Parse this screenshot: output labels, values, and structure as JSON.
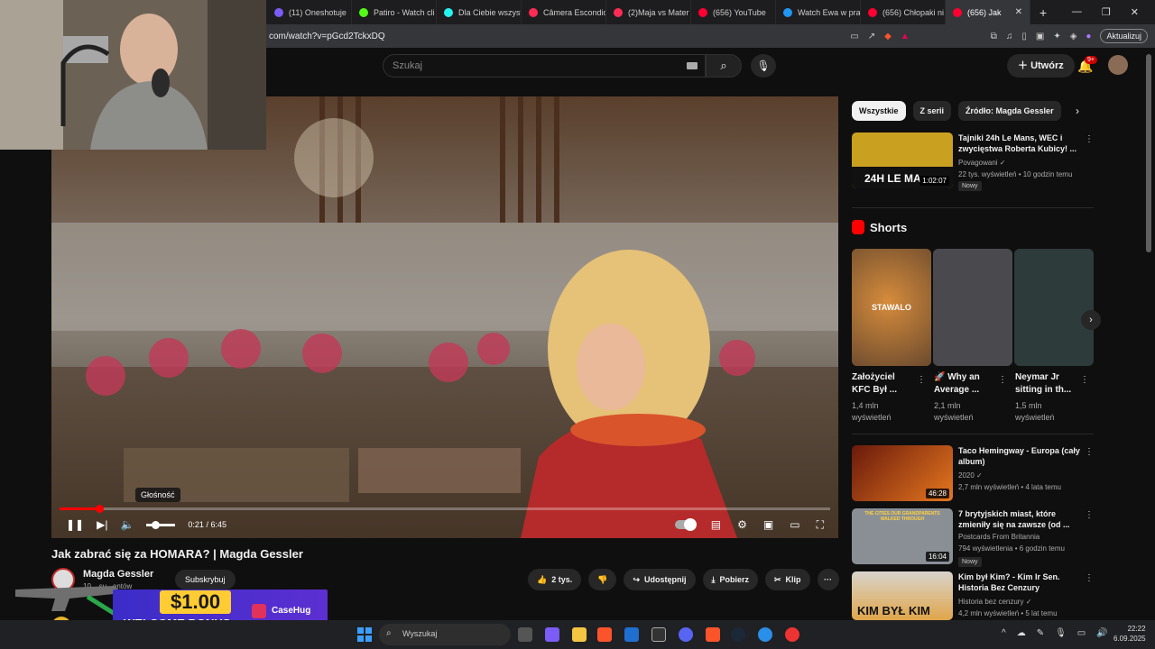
{
  "browser": {
    "tabs": [
      {
        "label": "(11) Oneshotuje",
        "color": "#7b5cf6"
      },
      {
        "label": "Patiro - Watch cli",
        "color": "#53fc18"
      },
      {
        "label": "Dla Ciebie wszyst",
        "color": "#25f4ee"
      },
      {
        "label": "Câmera Escondid",
        "color": "#fe2c55"
      },
      {
        "label": "(2)Maja vs Mater",
        "color": "#fe2c55"
      },
      {
        "label": "(656) YouTube",
        "color": "#ff0033"
      },
      {
        "label": "Watch Ewa w pra",
        "color": "#2196f3"
      },
      {
        "label": "(656) Chłopaki ni",
        "color": "#ff0033"
      },
      {
        "label": "(656) Jak",
        "color": "#ff0033",
        "active": true
      }
    ],
    "new_tab": "+",
    "url": "com/watch?v=pGcd2TckxDQ",
    "update_label": "Aktualizuj",
    "window_controls": [
      "—",
      "❐",
      "✕"
    ]
  },
  "header": {
    "search_placeholder": "Szukaj",
    "create_label": "Utwórz",
    "notifications": "9+"
  },
  "player": {
    "tooltip": "Głośność",
    "time": "0:21 / 6:45",
    "progress": 0.052,
    "volume": 0.3
  },
  "video": {
    "title": "Jak zabrać się za HOMARA? | Magda Gessler",
    "channel": "Magda Gessler",
    "subs_text": "10... su...entów",
    "subscribe_label": "Subskrybuj",
    "likes": "2 tys.",
    "share_label": "Udostępnij",
    "download_label": "Pobierz",
    "clip_label": "Klip",
    "more": "···"
  },
  "promo": {
    "amount": "$1.00",
    "sub": "WELCOME BONUS",
    "brand": "CaseHug"
  },
  "chips": [
    "Wszystkie",
    "Z serii",
    "Źródło: Magda Gessler"
  ],
  "recommendations_top": [
    {
      "title": "Tajniki 24h Le Mans, WEC i zwycięstwa Roberta Kubicy! ...",
      "channel": "Povagowani ✓",
      "meta": "22 tys. wyświetleń • 10 godzin temu",
      "badge": "Nowy",
      "duration": "1:02:07",
      "thumb_text": "24H LE MA"
    }
  ],
  "shorts": {
    "heading": "Shorts",
    "items": [
      {
        "title": "Założyciel KFC Był ...",
        "views": "1,4 mln wyświetleń",
        "thumb_text": "STAWALO"
      },
      {
        "title": "🚀 Why an Average ...",
        "views": "2,1 mln wyświetleń"
      },
      {
        "title": "Neymar Jr sitting in th...",
        "views": "1,5 mln wyświetleń"
      }
    ]
  },
  "recommendations": [
    {
      "title": "Taco Hemingway - Europa (cały album)",
      "channel": "2020 ✓",
      "meta": "2,7 mln wyświetleń • 4 lata temu",
      "duration": "46:28"
    },
    {
      "title": "7 brytyjskich miast, które zmieniły się na zawsze (od ...",
      "channel": "Postcards From Britannia",
      "meta": "794 wyświetlenia • 6 godzin temu",
      "badge": "Nowy",
      "duration": "16:04",
      "thumb_text": "THE CITIES OUR GRANDPARENTS WALKED THROUGH"
    },
    {
      "title": "Kim był Kim? - Kim Ir Sen. Historia Bez Cenzury",
      "channel": "Historia bez cenzury ✓",
      "meta": "4,2 mln wyświetleń • 5 lat temu",
      "thumb_text": "KIM BYŁ KIM"
    }
  ],
  "taskbar": {
    "search_placeholder": "Wyszukaj",
    "time": "22:22",
    "date": "6.09.2025"
  }
}
